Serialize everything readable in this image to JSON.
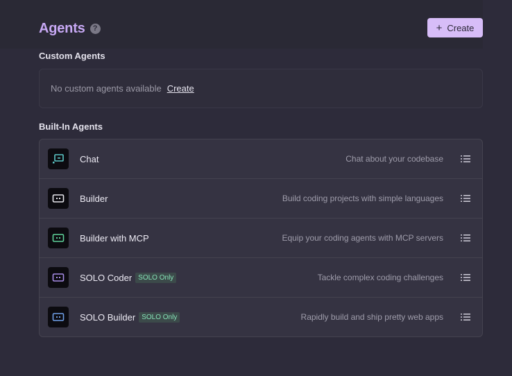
{
  "header": {
    "title": "Agents",
    "help_glyph": "?",
    "create_button_icon": "+",
    "create_button_label": "Create"
  },
  "custom_section": {
    "title": "Custom Agents",
    "empty_text": "No custom agents available",
    "create_link": "Create"
  },
  "builtin_section": {
    "title": "Built-In Agents",
    "agents": [
      {
        "name": "Chat",
        "badge": "",
        "description": "Chat about your codebase",
        "icon": "chat-bubble-icon",
        "icon_color": "#5cc8c8"
      },
      {
        "name": "Builder",
        "badge": "",
        "description": "Build coding projects with simple languages",
        "icon": "builder-icon",
        "icon_color": "#e8e8ee"
      },
      {
        "name": "Builder with MCP",
        "badge": "",
        "description": "Equip your coding agents with MCP servers",
        "icon": "builder-mcp-icon",
        "icon_color": "#5ed39a"
      },
      {
        "name": "SOLO Coder",
        "badge": "SOLO Only",
        "description": "Tackle complex coding challenges",
        "icon": "solo-coder-icon",
        "icon_color": "#a88de8"
      },
      {
        "name": "SOLO Builder",
        "badge": "SOLO Only",
        "description": "Rapidly build and ship pretty web apps",
        "icon": "solo-builder-icon",
        "icon_color": "#6f9fe8"
      }
    ]
  },
  "colors": {
    "accent": "#c8a9f5",
    "button_bg": "#d7bdf8",
    "badge_text": "#86e3b8",
    "background": "#2d2b3a"
  }
}
